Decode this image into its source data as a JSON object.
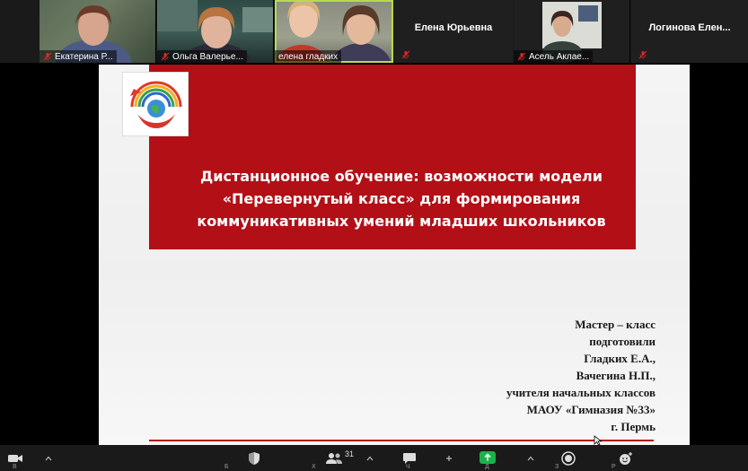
{
  "participants": [
    {
      "name": "Екатерина Р...",
      "muted": true,
      "video": true
    },
    {
      "name": "Ольга Валерье...",
      "muted": true,
      "video": true
    },
    {
      "name": "елена гладких",
      "muted": false,
      "video": true,
      "speaking": true
    },
    {
      "name": "Елена Юрьевна",
      "muted": true,
      "video": false
    },
    {
      "name": "Асель Аклае...",
      "muted": true,
      "video": true
    },
    {
      "name": "Логинова Елен...",
      "muted": true,
      "video": false
    }
  ],
  "slide": {
    "logo_text": "ГИМНАЗИЯ №33",
    "title": "Дистанционное обучение: возможности модели\n«Перевернутый класс» для формирования\nкоммуникативных умений младших школьников",
    "credits": [
      "Мастер – класс",
      "подготовили",
      "Гладких Е.А.,",
      "Вачегина Н.П.,",
      "учителя начальных классов",
      "МАОУ «Гимназия №33»",
      "г. Пермь"
    ]
  },
  "toolbar": {
    "participants_count": "31",
    "labels": [
      "В",
      "Б",
      "Х",
      "Ч",
      "Д",
      "З",
      "Р"
    ]
  },
  "colors": {
    "slide_red": "#b30f16",
    "mute_red": "#e02828",
    "share_green": "#19b34a",
    "speaker_outline": "#b8d94f"
  }
}
